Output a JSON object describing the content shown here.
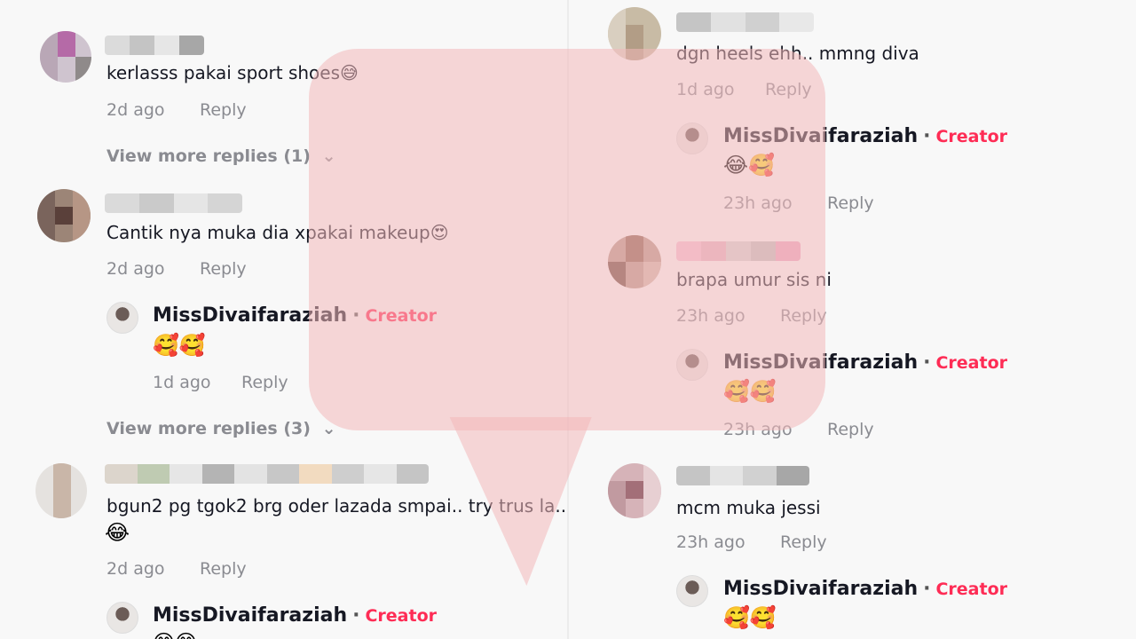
{
  "creator": {
    "name": "MissDivaifaraziah",
    "badge": "Creator",
    "separator": "·"
  },
  "reply_label": "Reply",
  "left": {
    "comments": [
      {
        "text": "kerlasss pakai sport shoes😅",
        "time": "2d ago",
        "view_more": "View more replies (1)"
      },
      {
        "text": "Cantik nya muka dia xpakai makeup😍",
        "time": "2d ago",
        "creator_reply": {
          "emoji": "🥰🥰",
          "time": "1d ago"
        },
        "view_more": "View more replies (3)"
      },
      {
        "text": "bgun2 pg tgok2 brg oder lazada smpai.. try trus la..!",
        "text2": "😂",
        "time": "2d ago",
        "creator_reply": {
          "emoji": "😊😊",
          "time": ""
        }
      }
    ]
  },
  "right": {
    "comments": [
      {
        "text": "dgn heels ehh.. mmng diva",
        "time": "1d ago",
        "creator_reply": {
          "emoji": "😂🥰",
          "time": "23h ago"
        }
      },
      {
        "text": "brapa umur sis ni",
        "time": "23h ago",
        "creator_reply": {
          "emoji": "🥰🥰",
          "time": "23h ago"
        }
      },
      {
        "text": "mcm muka jessi",
        "time": "23h ago",
        "creator_reply": {
          "emoji": "🥰🥰",
          "time": ""
        }
      }
    ]
  },
  "chevron": "⌄"
}
